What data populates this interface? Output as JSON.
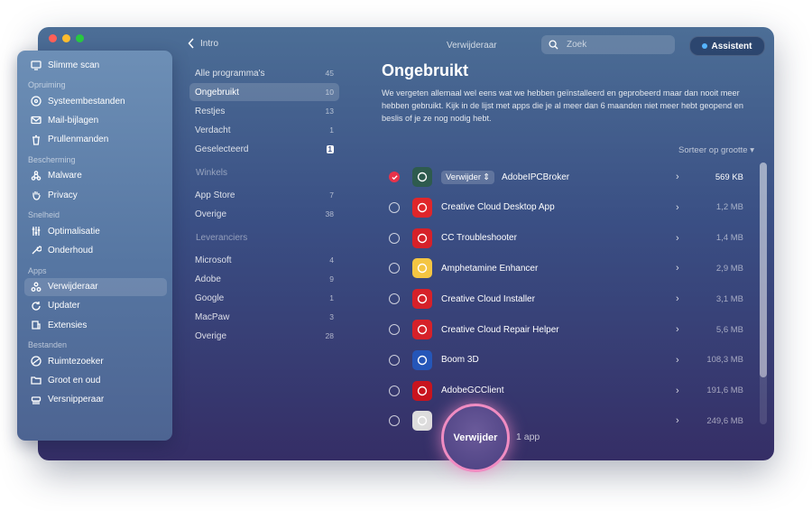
{
  "window": {
    "title": "Verwijderaar"
  },
  "traffic_lights": [
    "#ff5f57",
    "#febc2e",
    "#28c840"
  ],
  "sidebar": {
    "items": [
      {
        "label": "Slimme scan",
        "icon": "monitor-icon"
      },
      {
        "section": "Opruiming"
      },
      {
        "label": "Systeembestanden",
        "icon": "disc-icon"
      },
      {
        "label": "Mail-bijlagen",
        "icon": "envelope-icon"
      },
      {
        "label": "Prullenmanden",
        "icon": "trash-icon"
      },
      {
        "section": "Bescherming"
      },
      {
        "label": "Malware",
        "icon": "biohazard-icon"
      },
      {
        "label": "Privacy",
        "icon": "hand-icon"
      },
      {
        "section": "Snelheid"
      },
      {
        "label": "Optimalisatie",
        "icon": "sliders-icon"
      },
      {
        "label": "Onderhoud",
        "icon": "wrench-icon"
      },
      {
        "section": "Apps"
      },
      {
        "label": "Verwijderaar",
        "icon": "apps-icon",
        "active": true
      },
      {
        "label": "Updater",
        "icon": "update-icon"
      },
      {
        "label": "Extensies",
        "icon": "extension-icon"
      },
      {
        "section": "Bestanden"
      },
      {
        "label": "Ruimtezoeker",
        "icon": "space-icon"
      },
      {
        "label": "Groot en oud",
        "icon": "folder-icon"
      },
      {
        "label": "Versnipperaar",
        "icon": "shredder-icon"
      }
    ]
  },
  "topbar": {
    "back_label": "Intro",
    "title": "Verwijderaar",
    "search_placeholder": "Zoek",
    "assistant_label": "Assistent"
  },
  "middle": {
    "groups": [
      {
        "header": "",
        "rows": [
          {
            "label": "Alle programma's",
            "count": "45"
          },
          {
            "label": "Ongebruikt",
            "count": "10",
            "active": true
          },
          {
            "label": "Restjes",
            "count": "13"
          },
          {
            "label": "Verdacht",
            "count": "1"
          },
          {
            "label": "Geselecteerd",
            "count": "1",
            "badge": true
          }
        ]
      },
      {
        "header": "Winkels",
        "rows": [
          {
            "label": "App Store",
            "count": "7"
          },
          {
            "label": "Overige",
            "count": "38"
          }
        ]
      },
      {
        "header": "Leveranciers",
        "rows": [
          {
            "label": "Microsoft",
            "count": "4"
          },
          {
            "label": "Adobe",
            "count": "9"
          },
          {
            "label": "Google",
            "count": "1"
          },
          {
            "label": "MacPaw",
            "count": "3"
          },
          {
            "label": "Overige",
            "count": "28"
          }
        ]
      }
    ]
  },
  "main": {
    "heading": "Ongebruikt",
    "description": "We vergeten allemaal wel eens wat we hebben geïnstalleerd en geprobeerd maar dan nooit meer hebben gebruikt. Kijk in de lijst met apps die je al meer dan 6 maanden niet meer hebt geopend en beslis of je ze nog nodig hebt.",
    "sort_label": "Sorteer op grootte",
    "remove_inline_label": "Verwijder",
    "apps": [
      {
        "name": "AdobeIPCBroker",
        "size": "569 KB",
        "selected": true,
        "icon": "ipc-broker-icon",
        "color": "#2e5b4e"
      },
      {
        "name": "Creative Cloud Desktop App",
        "size": "1,2 MB",
        "icon": "creative-cloud-icon",
        "color": "#e0262a"
      },
      {
        "name": "CC Troubleshooter",
        "size": "1,4 MB",
        "icon": "cc-troubleshooter-icon",
        "color": "#d62129"
      },
      {
        "name": "Amphetamine Enhancer",
        "size": "2,9 MB",
        "icon": "amphetamine-icon",
        "color": "#f4c542"
      },
      {
        "name": "Creative Cloud Installer",
        "size": "3,1 MB",
        "icon": "cc-installer-icon",
        "color": "#d62129"
      },
      {
        "name": "Creative Cloud Repair Helper",
        "size": "5,6 MB",
        "icon": "cc-repair-icon",
        "color": "#d62129"
      },
      {
        "name": "Boom 3D",
        "size": "108,3 MB",
        "icon": "boom3d-icon",
        "color": "#2556b8"
      },
      {
        "name": "AdobeGCClient",
        "size": "191,6 MB",
        "icon": "adobe-gc-icon",
        "color": "#c8141e"
      },
      {
        "name": "",
        "size": "249,6 MB",
        "icon": "package-icon",
        "color": "#dddddd"
      }
    ]
  },
  "action": {
    "button_label": "Verwijder",
    "count_label": "1 app"
  }
}
